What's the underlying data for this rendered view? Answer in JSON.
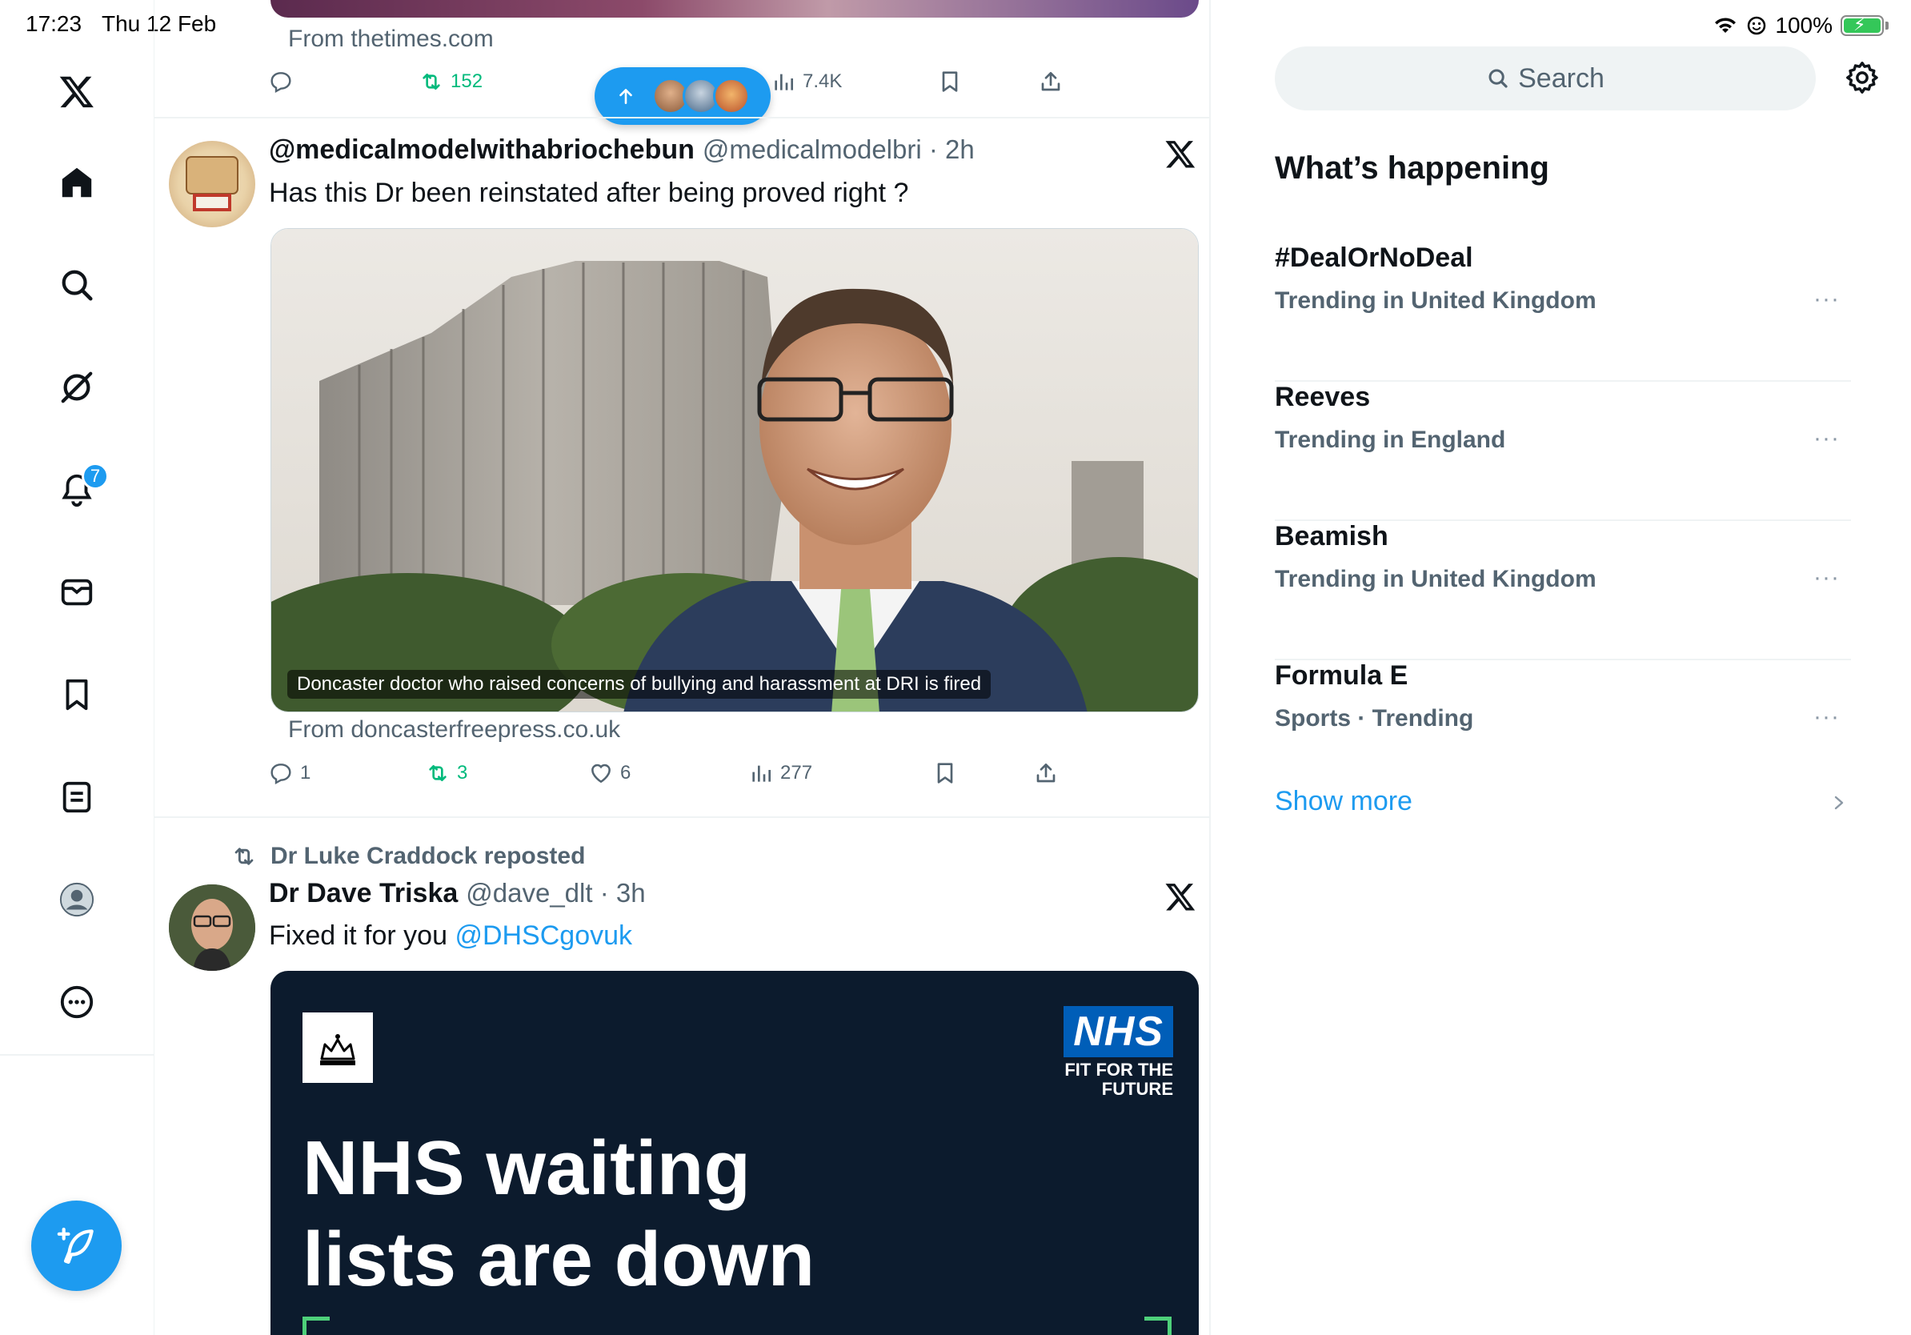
{
  "status_bar": {
    "time": "17:23",
    "date": "Thu 12 Feb",
    "battery": "100%"
  },
  "nav": {
    "notification_count": "7"
  },
  "tweet0": {
    "source": "From thetimes.com",
    "retweets": "152",
    "views": "7.4K"
  },
  "tweet1": {
    "display_name": "@medicalmodelwithabriochebun",
    "handle": "@medicalmodelbri · 2h",
    "text": "Has this Dr been reinstated after being proved right ?",
    "caption": "Doncaster doctor who raised concerns of bullying and harassment at DRI is fired",
    "source": "From doncasterfreepress.co.uk",
    "replies": "1",
    "retweets": "3",
    "likes": "6",
    "views": "277"
  },
  "tweet2": {
    "reposted_by": "Dr Luke Craddock reposted",
    "display_name": "Dr Dave Triska",
    "handle": "@dave_dlt · 3h",
    "text": "Fixed it for you",
    "mention": "@DHSCgovuk",
    "nhs_logo": "NHS",
    "nhs_tagline_1": "FIT FOR THE",
    "nhs_tagline_2": "FUTURE",
    "headline_1": "NHS waiting",
    "headline_2": "lists are down"
  },
  "sidebar": {
    "search_placeholder": "Search",
    "section_title": "What’s happening",
    "trends": [
      {
        "name": "#DealOrNoDeal",
        "context": "Trending in United Kingdom"
      },
      {
        "name": "Reeves",
        "context": "Trending in England"
      },
      {
        "name": "Beamish",
        "context": "Trending in United Kingdom"
      },
      {
        "name": "Formula E",
        "context": "Sports · Trending"
      }
    ],
    "more_glyph": "···",
    "show_more": "Show more"
  },
  "colors": {
    "accent": "#1d9bf0",
    "retweet_green": "#00ba7c",
    "secondary_text": "#536471",
    "divider": "#eff3f4"
  }
}
